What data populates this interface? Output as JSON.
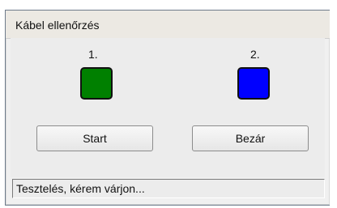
{
  "top_strip": {
    "text": ""
  },
  "window": {
    "title": "Kábel ellenőrzés",
    "channels": [
      {
        "label": "1.",
        "indicator_color": "#008000",
        "indicator_name": "green"
      },
      {
        "label": "2.",
        "indicator_color": "#0000ff",
        "indicator_name": "blue"
      }
    ],
    "buttons": {
      "start_label": "Start",
      "close_label": "Bezár"
    },
    "status_text": "Tesztelés, kérem várjon..."
  }
}
